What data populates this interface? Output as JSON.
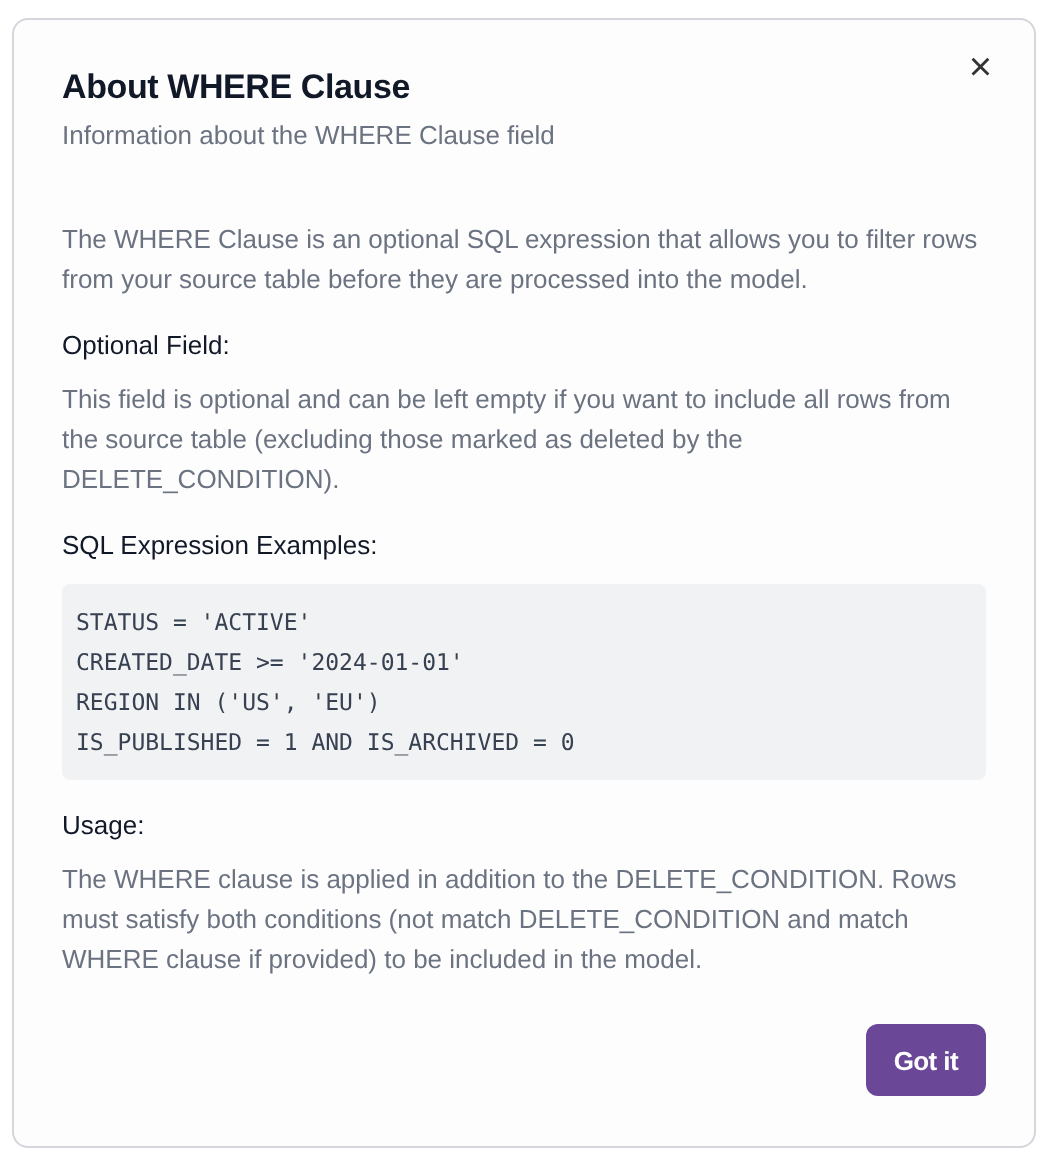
{
  "dialog": {
    "title": "About WHERE Clause",
    "subtitle": "Information about the WHERE Clause field",
    "close": "×",
    "intro": "The WHERE Clause is an optional SQL expression that allows you to filter rows from your source table before they are processed into the model.",
    "sections": [
      {
        "heading": "Optional Field:",
        "kind": "text",
        "text": "This field is optional and can be left empty if you want to include all rows from the source table (excluding those marked as deleted by the DELETE_CONDITION)."
      },
      {
        "heading": "SQL Expression Examples:",
        "kind": "code",
        "lines": [
          "STATUS = 'ACTIVE'",
          "CREATED_DATE >= '2024-01-01'",
          "REGION IN ('US', 'EU')",
          "IS_PUBLISHED = 1 AND IS_ARCHIVED = 0"
        ]
      },
      {
        "heading": "Usage:",
        "kind": "text",
        "text": "The WHERE clause is applied in addition to the DELETE_CONDITION. Rows must satisfy both conditions (not match DELETE_CONDITION and match WHERE clause if provided) to be included in the model."
      }
    ],
    "button": "Got it"
  }
}
